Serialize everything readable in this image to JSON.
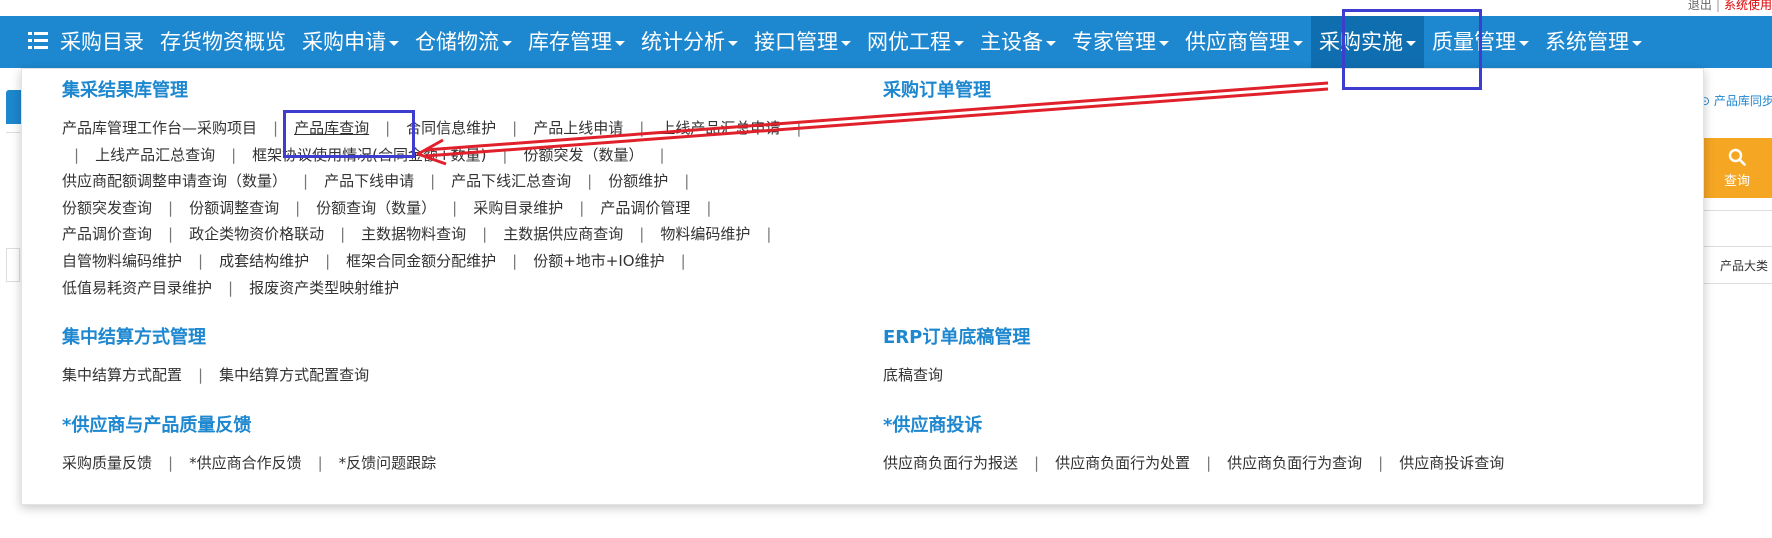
{
  "topbar": {
    "logout": "退出",
    "separator": "|",
    "system_use": "系统使用"
  },
  "nav": {
    "menu_icon": "hamburger-menu-icon",
    "items": [
      {
        "label": "采购目录",
        "has_caret": false
      },
      {
        "label": "存货物资概览",
        "has_caret": false
      },
      {
        "label": "采购申请",
        "has_caret": true
      },
      {
        "label": "仓储物流",
        "has_caret": true
      },
      {
        "label": "库存管理",
        "has_caret": true
      },
      {
        "label": "统计分析",
        "has_caret": true
      },
      {
        "label": "接口管理",
        "has_caret": true
      },
      {
        "label": "网优工程",
        "has_caret": true
      },
      {
        "label": "主设备",
        "has_caret": true
      },
      {
        "label": "专家管理",
        "has_caret": true
      },
      {
        "label": "供应商管理",
        "has_caret": true
      },
      {
        "label": "采购实施",
        "has_caret": true,
        "active": true
      },
      {
        "label": "质量管理",
        "has_caret": true
      },
      {
        "label": "系统管理",
        "has_caret": true
      }
    ]
  },
  "background": {
    "sync_label": "产品库同步",
    "query_label": "查询",
    "category_label": "产品大类"
  },
  "dropdown": {
    "separator": "|",
    "sections": {
      "jicai": {
        "title": "集采结果库管理",
        "rows": [
          [
            "产品库管理工作台—采购项目",
            "产品库查询",
            "合同信息维护",
            "产品上线申请",
            "上线产品汇总申请"
          ],
          [
            "上线产品汇总查询",
            "框架协议使用情况(合同金额+数量)",
            "份额突发（数量）"
          ],
          [
            "供应商配额调整申请查询（数量）",
            "产品下线申请",
            "产品下线汇总查询",
            "份额维护"
          ],
          [
            "份额突发查询",
            "份额调整查询",
            "份额查询（数量）",
            "采购目录维护",
            "产品调价管理"
          ],
          [
            "产品调价查询",
            "政企类物资价格联动",
            "主数据物料查询",
            "主数据供应商查询",
            "物料编码维护"
          ],
          [
            "自管物料编码维护",
            "成套结构维护",
            "框架合同金额分配维护",
            "份额+地市+IO维护"
          ],
          [
            "低值易耗资产目录维护",
            "报废资产类型映射维护"
          ]
        ]
      },
      "order": {
        "title": "采购订单管理",
        "rows": []
      },
      "settle": {
        "title": "集中结算方式管理",
        "rows": [
          [
            "集中结算方式配置",
            "集中结算方式配置查询"
          ]
        ]
      },
      "erp": {
        "title": "ERP订单底稿管理",
        "rows": [
          [
            "底稿查询"
          ]
        ]
      },
      "feedback": {
        "title": "*供应商与产品质量反馈",
        "rows": [
          [
            "采购质量反馈",
            "*供应商合作反馈",
            "*反馈问题跟踪"
          ]
        ]
      },
      "complaint": {
        "title": "*供应商投诉",
        "rows": [
          [
            "供应商负面行为报送",
            "供应商负面行为处置",
            "供应商负面行为查询",
            "供应商投诉查询"
          ]
        ]
      }
    }
  },
  "colors": {
    "nav_bg": "#1d87cf",
    "nav_active": "#0f6eb0",
    "section_title": "#1d87cf",
    "highlight_box": "#3d3dcf",
    "arrow": "#e0202a",
    "query_button": "#f5a623"
  }
}
